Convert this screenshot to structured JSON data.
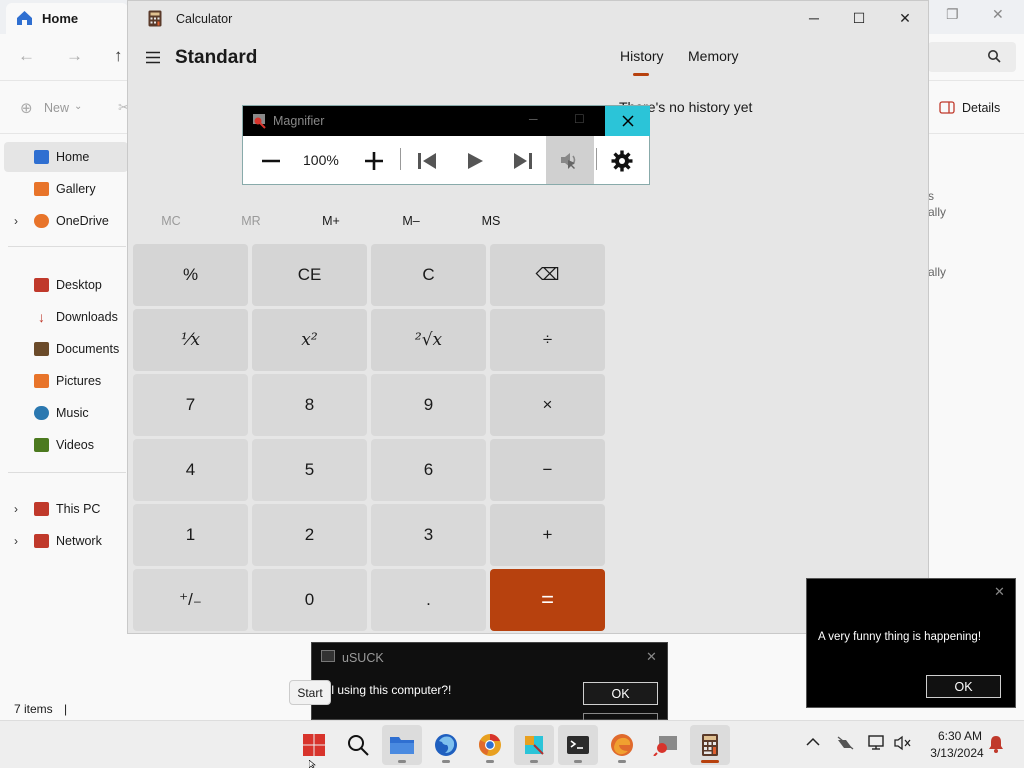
{
  "explorer": {
    "tab_title": "Home",
    "toolbar_new": "New",
    "toolbar_details": "Details",
    "sidebar": [
      {
        "label": "Home",
        "icon": "home-icon",
        "color": "#2f6fd1"
      },
      {
        "label": "Gallery",
        "icon": "gallery-icon",
        "color": "#e8742a"
      },
      {
        "label": "OneDrive",
        "icon": "onedrive-icon",
        "color": "#e8742a"
      },
      {
        "label": "Desktop",
        "icon": "desktop-icon",
        "color": "#c0392b"
      },
      {
        "label": "Downloads",
        "icon": "downloads-icon",
        "color": "#c0392b"
      },
      {
        "label": "Documents",
        "icon": "documents-icon",
        "color": "#6b4b2a"
      },
      {
        "label": "Pictures",
        "icon": "pictures-icon",
        "color": "#e8742a"
      },
      {
        "label": "Music",
        "icon": "music-icon",
        "color": "#2b78b0"
      },
      {
        "label": "Videos",
        "icon": "videos-icon",
        "color": "#4c7a1f"
      },
      {
        "label": "This PC",
        "icon": "this-pc-icon",
        "color": "#c0392b"
      },
      {
        "label": "Network",
        "icon": "network-icon",
        "color": "#c0392b"
      }
    ],
    "right_fragments": [
      "s",
      "ally",
      "ally"
    ],
    "status_items": "7 items"
  },
  "calculator": {
    "window_title": "Calculator",
    "mode": "Standard",
    "tabs": [
      "History",
      "Memory"
    ],
    "history_empty": "There's no history yet",
    "memory_buttons": [
      "MC",
      "MR",
      "M+",
      "M–",
      "MS"
    ],
    "keys": [
      [
        "%",
        "CE",
        "C",
        "⌫"
      ],
      [
        "⅟x",
        "x²",
        "²√x",
        "÷"
      ],
      [
        "7",
        "8",
        "9",
        "×"
      ],
      [
        "4",
        "5",
        "6",
        "−"
      ],
      [
        "1",
        "2",
        "3",
        "+"
      ],
      [
        "⁺/₋",
        "0",
        ".",
        "="
      ]
    ],
    "accent": "#b7410e"
  },
  "magnifier": {
    "title": "Magnifier",
    "zoom": "100%"
  },
  "usuck_dialog": {
    "title": "uSUCK",
    "message": "ill using this computer?!",
    "ok_label": "OK"
  },
  "funny_dialog": {
    "message": "A very funny thing is happening!",
    "ok_label": "OK"
  },
  "tooltip": {
    "label": "Start"
  },
  "taskbar": {
    "apps": [
      "start-icon",
      "search-icon",
      "file-explorer-icon",
      "firefox-icon",
      "chrome-icon",
      "snipping-tool-icon",
      "terminal-icon",
      "edge-icon",
      "magnifier-app-icon",
      "calculator-app-icon"
    ],
    "time": "6:30 AM",
    "date": "3/13/2024"
  }
}
